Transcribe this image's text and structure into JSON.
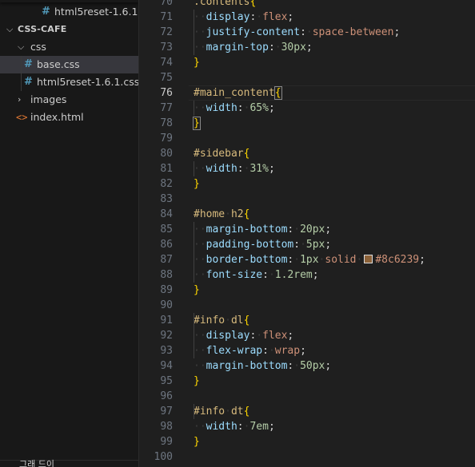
{
  "explorer": {
    "items": [
      {
        "label": "html5reset-1.6.1...",
        "kind": "file",
        "icon": "hash-icon"
      },
      {
        "label": "CSS-CAFE",
        "kind": "folder-root",
        "icon": "chevron-down-icon"
      },
      {
        "label": "css",
        "kind": "folder",
        "icon": "chevron-down-icon"
      },
      {
        "label": "base.css",
        "kind": "file",
        "icon": "hash-icon",
        "selected": true
      },
      {
        "label": "html5reset-1.6.1.css",
        "kind": "file",
        "icon": "hash-icon"
      },
      {
        "label": "images",
        "kind": "folder",
        "icon": "chevron-right-icon"
      },
      {
        "label": "index.html",
        "kind": "file",
        "icon": "html-icon"
      }
    ],
    "bottom_label": "그래 드이"
  },
  "editor": {
    "current_line": "76",
    "lines": [
      {
        "n": "70",
        "tokens": [
          [
            "sel",
            ".contents"
          ],
          [
            "brace",
            "{"
          ]
        ]
      },
      {
        "n": "71",
        "tokens": [
          [
            "ws",
            "··"
          ],
          [
            "prop",
            "display"
          ],
          [
            "punc",
            ":"
          ],
          [
            "ws",
            "·"
          ],
          [
            "val",
            "flex"
          ],
          [
            "punc",
            ";"
          ]
        ]
      },
      {
        "n": "72",
        "tokens": [
          [
            "ws",
            "··"
          ],
          [
            "prop",
            "justify-content"
          ],
          [
            "punc",
            ":"
          ],
          [
            "ws",
            "·"
          ],
          [
            "val",
            "space-between"
          ],
          [
            "punc",
            ";"
          ]
        ]
      },
      {
        "n": "73",
        "tokens": [
          [
            "ws",
            "··"
          ],
          [
            "prop",
            "margin-top"
          ],
          [
            "punc",
            ":"
          ],
          [
            "ws",
            "·"
          ],
          [
            "num",
            "30px"
          ],
          [
            "punc",
            ";"
          ]
        ]
      },
      {
        "n": "74",
        "tokens": [
          [
            "brace",
            "}"
          ]
        ]
      },
      {
        "n": "75",
        "tokens": []
      },
      {
        "n": "76",
        "tokens": [
          [
            "sel",
            "#main_content"
          ],
          [
            "brace-match",
            "{"
          ]
        ]
      },
      {
        "n": "77",
        "tokens": [
          [
            "ws",
            "··"
          ],
          [
            "prop",
            "width"
          ],
          [
            "punc",
            ":"
          ],
          [
            "ws",
            "·"
          ],
          [
            "num",
            "65%"
          ],
          [
            "punc",
            ";"
          ]
        ]
      },
      {
        "n": "78",
        "tokens": [
          [
            "brace-match",
            "}"
          ]
        ]
      },
      {
        "n": "79",
        "tokens": []
      },
      {
        "n": "80",
        "tokens": [
          [
            "sel",
            "#sidebar"
          ],
          [
            "brace",
            "{"
          ]
        ]
      },
      {
        "n": "81",
        "tokens": [
          [
            "ws",
            "··"
          ],
          [
            "prop",
            "width"
          ],
          [
            "punc",
            ":"
          ],
          [
            "ws",
            "·"
          ],
          [
            "num",
            "31%"
          ],
          [
            "punc",
            ";"
          ]
        ]
      },
      {
        "n": "82",
        "tokens": [
          [
            "brace",
            "}"
          ]
        ]
      },
      {
        "n": "83",
        "tokens": []
      },
      {
        "n": "84",
        "tokens": [
          [
            "sel",
            "#home"
          ],
          [
            "ws",
            "·"
          ],
          [
            "sel",
            "h2"
          ],
          [
            "brace",
            "{"
          ]
        ]
      },
      {
        "n": "85",
        "tokens": [
          [
            "ws",
            "··"
          ],
          [
            "prop",
            "margin-bottom"
          ],
          [
            "punc",
            ":"
          ],
          [
            "ws",
            "·"
          ],
          [
            "num",
            "20px"
          ],
          [
            "punc",
            ";"
          ]
        ]
      },
      {
        "n": "86",
        "tokens": [
          [
            "ws",
            "··"
          ],
          [
            "prop",
            "padding-bottom"
          ],
          [
            "punc",
            ":"
          ],
          [
            "ws",
            "·"
          ],
          [
            "num",
            "5px"
          ],
          [
            "punc",
            ";"
          ]
        ]
      },
      {
        "n": "87",
        "tokens": [
          [
            "ws",
            "··"
          ],
          [
            "prop",
            "border-bottom"
          ],
          [
            "punc",
            ":"
          ],
          [
            "ws",
            "·"
          ],
          [
            "num",
            "1px"
          ],
          [
            "ws",
            "·"
          ],
          [
            "val",
            "solid"
          ],
          [
            "ws",
            "·"
          ],
          [
            "swatch",
            "#8c6239"
          ],
          [
            "val",
            "#8c6239"
          ],
          [
            "punc",
            ";"
          ]
        ]
      },
      {
        "n": "88",
        "tokens": [
          [
            "ws",
            "··"
          ],
          [
            "prop",
            "font-size"
          ],
          [
            "punc",
            ":"
          ],
          [
            "ws",
            "·"
          ],
          [
            "num",
            "1.2rem"
          ],
          [
            "punc",
            ";"
          ]
        ]
      },
      {
        "n": "89",
        "tokens": [
          [
            "brace",
            "}"
          ]
        ]
      },
      {
        "n": "90",
        "tokens": []
      },
      {
        "n": "91",
        "tokens": [
          [
            "sel",
            "#info"
          ],
          [
            "ws",
            "·"
          ],
          [
            "sel",
            "dl"
          ],
          [
            "brace",
            "{"
          ]
        ]
      },
      {
        "n": "92",
        "tokens": [
          [
            "ws",
            "··"
          ],
          [
            "prop",
            "display"
          ],
          [
            "punc",
            ":"
          ],
          [
            "ws",
            "·"
          ],
          [
            "val",
            "flex"
          ],
          [
            "punc",
            ";"
          ]
        ]
      },
      {
        "n": "93",
        "tokens": [
          [
            "ws",
            "··"
          ],
          [
            "prop",
            "flex-wrap"
          ],
          [
            "punc",
            ":"
          ],
          [
            "ws",
            "·"
          ],
          [
            "val",
            "wrap"
          ],
          [
            "punc",
            ";"
          ]
        ]
      },
      {
        "n": "94",
        "tokens": [
          [
            "ws",
            "··"
          ],
          [
            "prop",
            "margin-bottom"
          ],
          [
            "punc",
            ":"
          ],
          [
            "ws",
            "·"
          ],
          [
            "num",
            "50px"
          ],
          [
            "punc",
            ";"
          ]
        ]
      },
      {
        "n": "95",
        "tokens": [
          [
            "brace",
            "}"
          ]
        ]
      },
      {
        "n": "96",
        "tokens": []
      },
      {
        "n": "97",
        "tokens": [
          [
            "sel",
            "#info"
          ],
          [
            "ws",
            "·"
          ],
          [
            "sel",
            "dt"
          ],
          [
            "brace",
            "{"
          ]
        ]
      },
      {
        "n": "98",
        "tokens": [
          [
            "ws",
            "··"
          ],
          [
            "prop",
            "width"
          ],
          [
            "punc",
            ":"
          ],
          [
            "ws",
            "·"
          ],
          [
            "num",
            "7em"
          ],
          [
            "punc",
            ";"
          ]
        ]
      },
      {
        "n": "99",
        "tokens": [
          [
            "brace",
            "}"
          ]
        ]
      },
      {
        "n": "100",
        "tokens": []
      }
    ]
  },
  "colors": {
    "selector": "#d7ba7d",
    "property": "#9cdcfe",
    "value": "#ce9178",
    "number": "#b5cea8",
    "brace": "#ffd700",
    "swatch": "#8c6239",
    "css_icon": "#519aba",
    "html_icon": "#e37933"
  }
}
